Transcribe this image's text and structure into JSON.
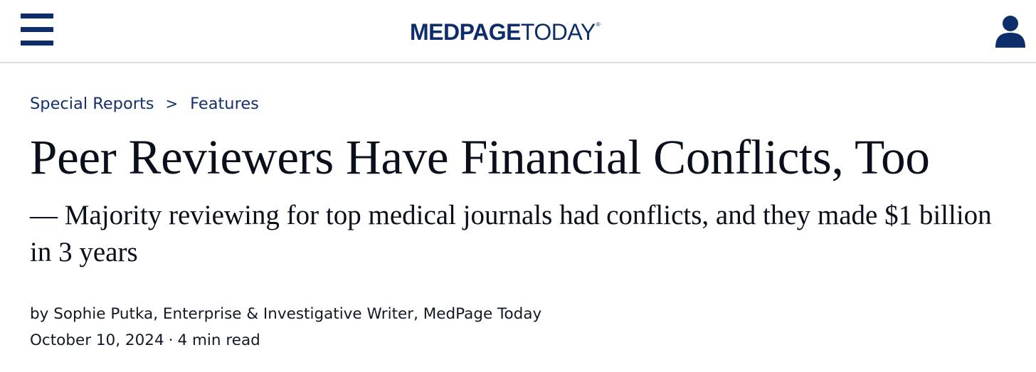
{
  "header": {
    "logo": {
      "bold": "MEDPAGE",
      "regular": "TODAY",
      "mark": "®"
    },
    "menu_icon": "hamburger-menu-icon",
    "user_icon": "user-account-icon",
    "brand_color": "#0e2d6b",
    "divider_color": "#dcdde0"
  },
  "breadcrumb": {
    "items": [
      "Special Reports",
      "Features"
    ],
    "separator": ">",
    "color": "#14306e"
  },
  "article": {
    "headline": "Peer Reviewers Have Financial Conflicts, Too",
    "deck": "— Majority reviewing for top medical journals had conflicts, and they made $1 billion in 3 years",
    "byline": {
      "prefix": "by",
      "author": "Sophie Putka",
      "role": ", Enterprise & Investigative Writer, MedPage Today"
    },
    "date": "October 10, 2024",
    "meta_separator": "·",
    "read_time": "4 min read"
  }
}
